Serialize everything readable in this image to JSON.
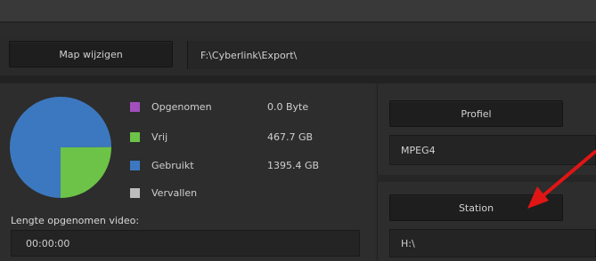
{
  "toolbar": {
    "map_change_label": "Map wijzigen",
    "path_value": "F:\\Cyberlink\\Export\\"
  },
  "disk_usage": {
    "legend": [
      {
        "label": "Opgenomen",
        "value": "0.0 Byte",
        "color": "#a24fbd"
      },
      {
        "label": "Vrij",
        "value": "467.7 GB",
        "color": "#6cc347"
      },
      {
        "label": "Gebruikt",
        "value": "1395.4 GB",
        "color": "#3c78bf"
      },
      {
        "label": "Vervallen",
        "value": "",
        "color": "#bdbdbd"
      }
    ],
    "chart_data": {
      "type": "pie",
      "categories": [
        "Opgenomen",
        "Vrij",
        "Gebruikt",
        "Vervallen"
      ],
      "values": [
        0.0,
        467.7,
        1395.4,
        0
      ],
      "colors": [
        "#a24fbd",
        "#6cc347",
        "#3c78bf",
        "#bdbdbd"
      ]
    }
  },
  "video_length": {
    "label": "Lengte opgenomen video:",
    "value": "00:00:00"
  },
  "profile": {
    "button_label": "Profiel",
    "value": "MPEG4"
  },
  "station": {
    "button_label": "Station",
    "value": "H:\\"
  },
  "annotation": {
    "arrow_color": "#e01515"
  }
}
